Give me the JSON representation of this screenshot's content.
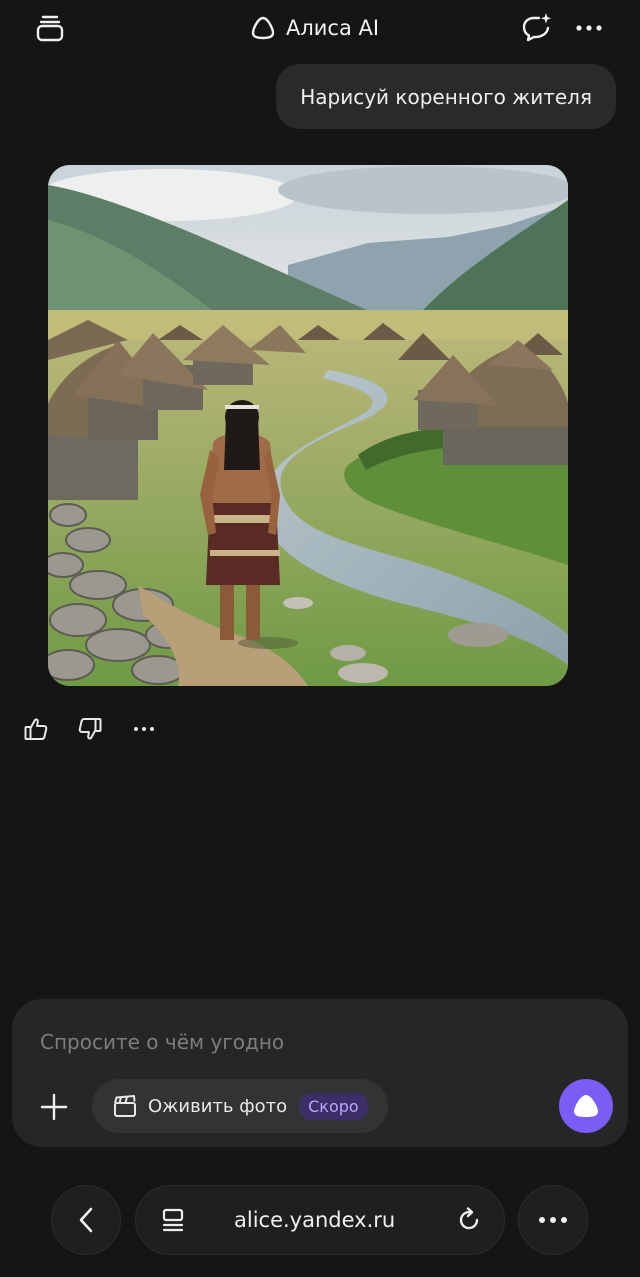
{
  "header": {
    "title": "Алиса AI",
    "left_icon": "tabs-stack-icon",
    "new_chat_icon": "new-chat-icon",
    "more_icon": "more-horizontal-icon"
  },
  "chat": {
    "user_message": "Нарисуй коренного жителя",
    "response_image": {
      "kind": "generated-image",
      "subject": "indigenous man in a village of thatched huts by a river"
    },
    "feedback": {
      "like_icon": "thumbs-up-icon",
      "dislike_icon": "thumbs-down-icon",
      "more_icon": "more-horizontal-icon"
    }
  },
  "composer": {
    "placeholder": "Спросите о чём угодно",
    "value": "",
    "add_icon": "plus-icon",
    "chip_label": "Оживить фото",
    "chip_badge": "Скоро",
    "chip_icon": "clapperboard-icon",
    "voice_icon": "alice-logo-icon"
  },
  "browser": {
    "url": "alice.yandex.ru",
    "back_icon": "chevron-left-icon",
    "reader_icon": "reader-mode-icon",
    "reload_icon": "reload-icon",
    "menu_icon": "more-horizontal-icon"
  },
  "colors": {
    "background": "#151515",
    "bubble": "#2a2a2a",
    "composer": "#262626",
    "accent": "#7b5cf5",
    "badge_bg": "#3c2f68",
    "badge_text": "#b9a6ff"
  }
}
